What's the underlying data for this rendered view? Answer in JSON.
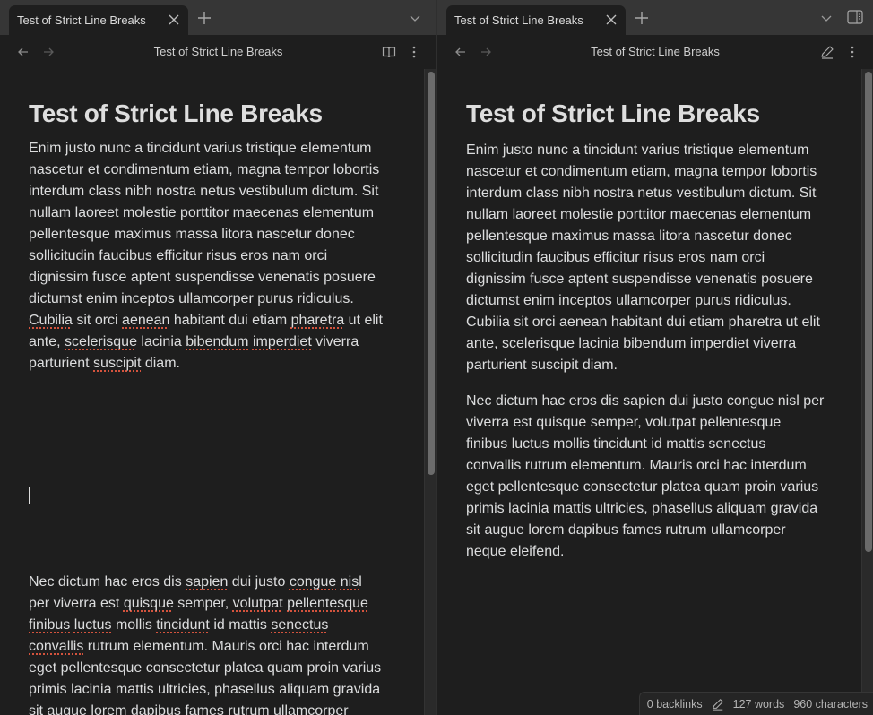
{
  "left_pane": {
    "tab": {
      "title": "Test of Strict Line Breaks"
    },
    "header": {
      "title": "Test of Strict Line Breaks",
      "mode_icon": "book-open-icon"
    },
    "doc": {
      "heading": "Test of Strict Line Breaks",
      "paragraph1": [
        [
          {
            "t": "Enim justo nunc a tincidunt varius tristique elementum"
          }
        ],
        [
          {
            "t": "nascetur et condimentum etiam, magna tempor lobortis"
          }
        ],
        [
          {
            "t": "interdum class nibh nostra netus vestibulum dictum. Sit"
          }
        ],
        [
          {
            "t": "nullam laoreet molestie porttitor maecenas elementum"
          }
        ],
        [
          {
            "t": "pellentesque maximus massa litora nascetur donec"
          }
        ],
        [
          {
            "t": "sollicitudin faucibus efficitur risus eros nam orci"
          }
        ],
        [
          {
            "t": "dignissim fusce aptent suspendisse venenatis posuere"
          }
        ],
        [
          {
            "t": "dictumst enim inceptos ullamcorper purus ridiculus."
          }
        ],
        [
          {
            "t": "Cubilia",
            "s": 1
          },
          {
            "t": " sit orci "
          },
          {
            "t": "aenean",
            "s": 1
          },
          {
            "t": " habitant dui etiam "
          },
          {
            "t": "pharetra",
            "s": 1
          },
          {
            "t": " ut elit"
          }
        ],
        [
          {
            "t": "ante, "
          },
          {
            "t": "scelerisque",
            "s": 1
          },
          {
            "t": " lacinia "
          },
          {
            "t": "bibendum",
            "s": 1
          },
          {
            "t": " "
          },
          {
            "t": "imperdiet",
            "s": 1
          },
          {
            "t": " viverra"
          }
        ],
        [
          {
            "t": "parturient "
          },
          {
            "t": "suscipit",
            "s": 1
          },
          {
            "t": " diam."
          }
        ]
      ],
      "paragraph2": [
        [
          {
            "t": "Nec dictum hac eros dis "
          },
          {
            "t": "sapien",
            "s": 1
          },
          {
            "t": " dui justo "
          },
          {
            "t": "congue",
            "s": 1
          },
          {
            "t": " "
          },
          {
            "t": "nisl",
            "s": 1
          }
        ],
        [
          {
            "t": "per viverra est "
          },
          {
            "t": "quisque",
            "s": 1
          },
          {
            "t": " semper, "
          },
          {
            "t": "volutpat",
            "s": 1
          },
          {
            "t": " "
          },
          {
            "t": "pellentesque",
            "s": 1
          }
        ],
        [
          {
            "t": "finibus",
            "s": 1
          },
          {
            "t": " "
          },
          {
            "t": "luctus",
            "s": 1
          },
          {
            "t": " mollis "
          },
          {
            "t": "tincidunt",
            "s": 1
          },
          {
            "t": " id mattis "
          },
          {
            "t": "senectus",
            "s": 1
          }
        ],
        [
          {
            "t": "convallis",
            "s": 1
          },
          {
            "t": " rutrum elementum. Mauris orci hac interdum"
          }
        ],
        [
          {
            "t": "eget pellentesque consectetur platea quam proin varius"
          }
        ],
        [
          {
            "t": "primis lacinia mattis ultricies, phasellus aliquam gravida"
          }
        ],
        [
          {
            "t": "sit augue lorem dapibus fames rutrum ullamcorper"
          }
        ]
      ]
    }
  },
  "right_pane": {
    "tab": {
      "title": "Test of Strict Line Breaks"
    },
    "header": {
      "title": "Test of Strict Line Breaks",
      "mode_icon": "pencil-icon"
    },
    "doc": {
      "heading": "Test of Strict Line Breaks",
      "paragraph1": [
        "Enim justo nunc a tincidunt varius tristique elementum",
        "nascetur et condimentum etiam, magna tempor lobortis",
        "interdum class nibh nostra netus vestibulum dictum. Sit",
        "nullam laoreet molestie porttitor maecenas elementum",
        "pellentesque maximus massa litora nascetur donec",
        "sollicitudin faucibus efficitur risus eros nam orci",
        "dignissim fusce aptent suspendisse venenatis posuere",
        "dictumst enim inceptos ullamcorper purus ridiculus.",
        "Cubilia sit orci aenean habitant dui etiam pharetra ut elit",
        "ante, scelerisque lacinia bibendum imperdiet viverra",
        "parturient suscipit diam."
      ],
      "paragraph2": [
        "Nec dictum hac eros dis sapien dui justo congue nisl per",
        "viverra est quisque semper, volutpat pellentesque",
        "finibus luctus mollis tincidunt id mattis senectus",
        "convallis rutrum elementum. Mauris orci hac interdum",
        "eget pellentesque consectetur platea quam proin varius",
        "primis lacinia mattis ultricies, phasellus aliquam gravida",
        "sit augue lorem dapibus fames rutrum ullamcorper",
        "neque eleifend."
      ]
    }
  },
  "statusbar": {
    "backlinks": "0 backlinks",
    "words": "127 words",
    "characters": "960 characters"
  },
  "colors": {
    "background": "#1e1e1e",
    "tabbar": "#363636",
    "text": "#dcddde",
    "spellcheck": "#d4533d"
  }
}
